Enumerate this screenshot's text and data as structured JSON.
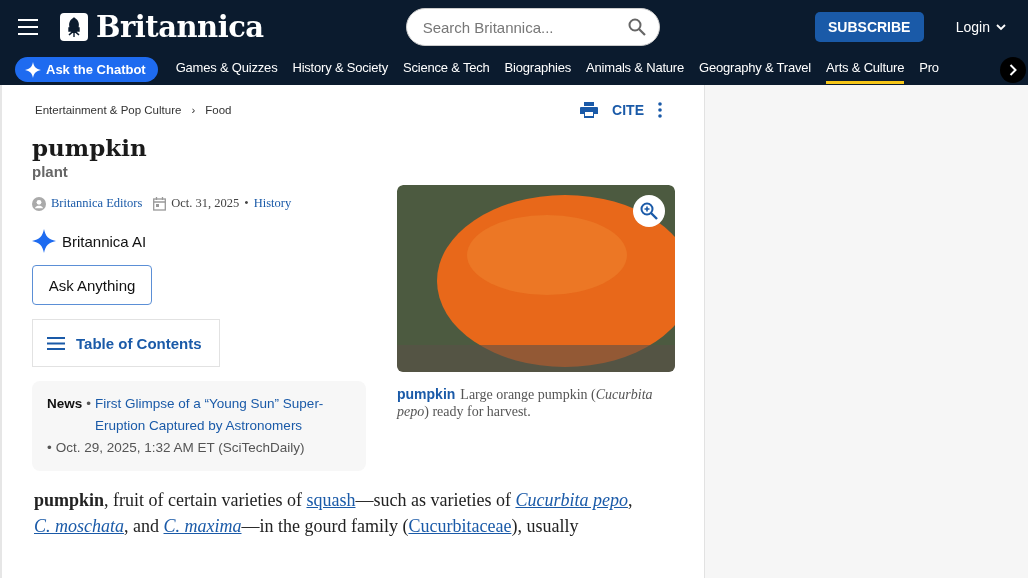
{
  "header": {
    "logo_text": "Britannica",
    "search": {
      "placeholder": "Search Britannica..."
    },
    "subscribe": "SUBSCRIBE",
    "login": "Login"
  },
  "nav": {
    "chatbot": "Ask the Chatbot",
    "items": [
      {
        "label": "Games & Quizzes",
        "selected": false
      },
      {
        "label": "History & Society",
        "selected": false
      },
      {
        "label": "Science & Tech",
        "selected": false
      },
      {
        "label": "Biographies",
        "selected": false
      },
      {
        "label": "Animals & Nature",
        "selected": false
      },
      {
        "label": "Geography & Travel",
        "selected": false
      },
      {
        "label": "Arts & Culture",
        "selected": true
      },
      {
        "label": "Pro",
        "selected": false
      }
    ]
  },
  "breadcrumbs": [
    "Entertainment & Pop Culture",
    "Food"
  ],
  "breadcrumb_separator": "›",
  "toolbar": {
    "cite": "CITE"
  },
  "article": {
    "title": "pumpkin",
    "subtitle": "plant",
    "author": "Britannica Editors",
    "date": "Oct. 31, 2025",
    "date_separator": "•",
    "history": "History",
    "ai": {
      "label": "Britannica AI",
      "button": "Ask Anything"
    },
    "toc": "Table of Contents",
    "news": {
      "label": "News",
      "separator": "•",
      "meta_separator": "•",
      "headline": "First Glimpse of a “Young Sun” Super-Eruption Captured by Astronomers",
      "meta": "Oct. 29, 2025, 1:32 AM ET (SciTechDaily)"
    },
    "figure": {
      "caption_title": "pumpkin",
      "caption": "Large orange pumpkin (*Cucurbita pepo*) ready for harvest."
    },
    "body": [
      {
        "kind": "text",
        "text": "**pumpkin**, fruit of certain varieties of "
      },
      {
        "kind": "link",
        "text": "squash",
        "italic": false
      },
      {
        "kind": "text",
        "text": "—such as varieties of "
      },
      {
        "kind": "link",
        "text": "Cucurbita pepo",
        "italic": true
      },
      {
        "kind": "text",
        "text": ", "
      },
      {
        "kind": "link",
        "text": "C. moschata",
        "italic": true
      },
      {
        "kind": "text",
        "text": ", and "
      },
      {
        "kind": "link",
        "text": "C. maxima",
        "italic": true
      },
      {
        "kind": "text",
        "text": "—in the gourd family ("
      },
      {
        "kind": "link",
        "text": "Cucurbitaceae",
        "italic": false
      },
      {
        "kind": "text",
        "text": "), usually"
      }
    ]
  }
}
